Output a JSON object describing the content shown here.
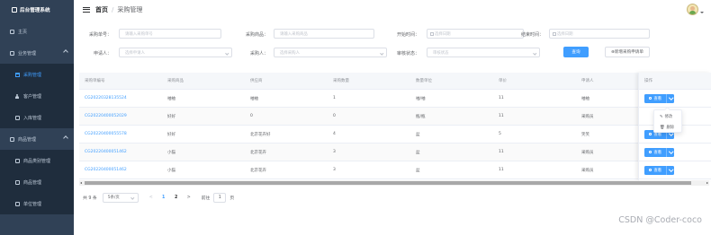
{
  "app": {
    "name": "后台管理系统"
  },
  "sidebar": {
    "items": [
      {
        "label": "主页"
      },
      {
        "label": "业务管理"
      },
      {
        "label": "采购管理"
      },
      {
        "label": "客户管理"
      },
      {
        "label": "入库管理"
      },
      {
        "label": "商品管理"
      },
      {
        "label": "商品类别管理"
      },
      {
        "label": "商品管理"
      },
      {
        "label": "单位管理"
      }
    ]
  },
  "header": {
    "home": "首页",
    "sep": "/",
    "current": "采购管理"
  },
  "filters": {
    "purchase_no": {
      "label": "采购单号：",
      "placeholder": "请输入采购单号"
    },
    "product": {
      "label": "采购商品：",
      "placeholder": "请输入采购商品"
    },
    "start_time": {
      "label": "开始时间：",
      "placeholder": "选择日期"
    },
    "end_time": {
      "label": "结束时间：",
      "placeholder": "选择日期"
    },
    "applicant": {
      "label": "申请人：",
      "placeholder": "选择申请人"
    },
    "purchaser": {
      "label": "采购人：",
      "placeholder": "选择采购人"
    },
    "audit_status": {
      "label": "审核状态：",
      "placeholder": "审核状态"
    },
    "query_btn": "查询",
    "add_btn": "⊕新增采购申请单"
  },
  "table": {
    "columns": [
      "采购单编号",
      "采购商品",
      "供应商",
      "采购数量",
      "数量单位",
      "单价",
      "申请人",
      "操作"
    ],
    "rows": [
      [
        "CG20220328135524",
        "袖袖",
        "袖袖",
        "1",
        "袖/袖",
        "11",
        "袖袖"
      ],
      [
        "CG20220400052029",
        "好好",
        "0",
        "0",
        "瓶/瓶",
        "11",
        "采购员"
      ],
      [
        "CG20220400055578",
        "好好",
        "北京花卉好",
        "4",
        "盆",
        "5",
        "笑笑"
      ],
      [
        "CG20220400051462",
        "小猫",
        "北京花卉",
        "3",
        "盆",
        "11",
        "采购员"
      ],
      [
        "CG20220400051462",
        "小猫",
        "北京花卉",
        "3",
        "盆",
        "11",
        "采购员"
      ]
    ],
    "view_label": "查看",
    "dropdown": {
      "edit": "修改",
      "delete": "删除"
    }
  },
  "pagination": {
    "total": "共 9 条",
    "page_size": "5条/页",
    "pages": [
      "1",
      "2"
    ],
    "current_page": "2",
    "prev": "<",
    "next": ">",
    "jump_label": "前往",
    "jump_value": "1",
    "jump_suffix": "页"
  },
  "watermark": "CSDN @Coder-coco",
  "colors": {
    "sidebar": "#304156",
    "accent": "#409eff"
  }
}
